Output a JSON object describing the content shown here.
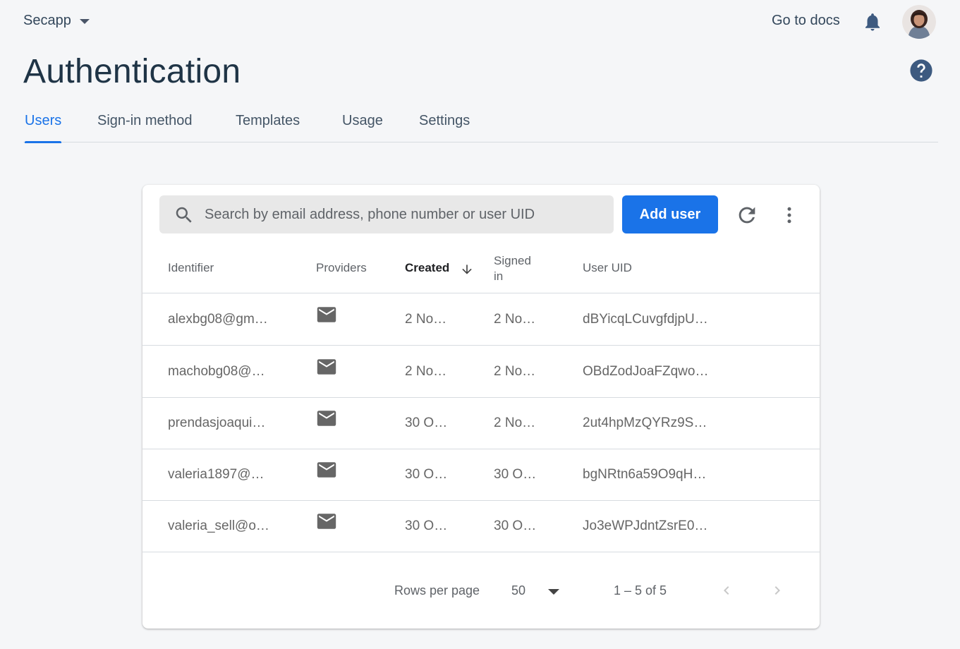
{
  "header": {
    "project_name": "Secapp",
    "docs_link": "Go to docs"
  },
  "page": {
    "title": "Authentication"
  },
  "tabs": [
    {
      "label": "Users",
      "active": true
    },
    {
      "label": "Sign-in method",
      "active": false
    },
    {
      "label": "Templates",
      "active": false
    },
    {
      "label": "Usage",
      "active": false
    },
    {
      "label": "Settings",
      "active": false
    }
  ],
  "toolbar": {
    "search_placeholder": "Search by email address, phone number or user UID",
    "add_user_label": "Add user"
  },
  "table": {
    "columns": [
      "Identifier",
      "Providers",
      "Created",
      "Signed\nin",
      "User UID"
    ],
    "sorted_column": "Created",
    "rows": [
      {
        "identifier": "alexbg08@gm…",
        "provider": "email",
        "created": "2 No…",
        "signed_in": "2 No…",
        "uid": "dBYicqLCuvgfdjpU…"
      },
      {
        "identifier": "machobg08@…",
        "provider": "email",
        "created": "2 No…",
        "signed_in": "2 No…",
        "uid": "OBdZodJoaFZqwo…"
      },
      {
        "identifier": "prendasjoaqui…",
        "provider": "email",
        "created": "30 O…",
        "signed_in": "2 No…",
        "uid": "2ut4hpMzQYRz9S…"
      },
      {
        "identifier": "valeria1897@…",
        "provider": "email",
        "created": "30 O…",
        "signed_in": "30 O…",
        "uid": "bgNRtn6a59O9qH…"
      },
      {
        "identifier": "valeria_sell@o…",
        "provider": "email",
        "created": "30 O…",
        "signed_in": "30 O…",
        "uid": "Jo3eWPJdntZsrE0…"
      }
    ]
  },
  "pagination": {
    "rows_per_page_label": "Rows per page",
    "rows_per_page_value": "50",
    "range_label": "1 – 5 of 5"
  },
  "colors": {
    "accent": "#1a73e8",
    "background": "#f5f6f8"
  }
}
